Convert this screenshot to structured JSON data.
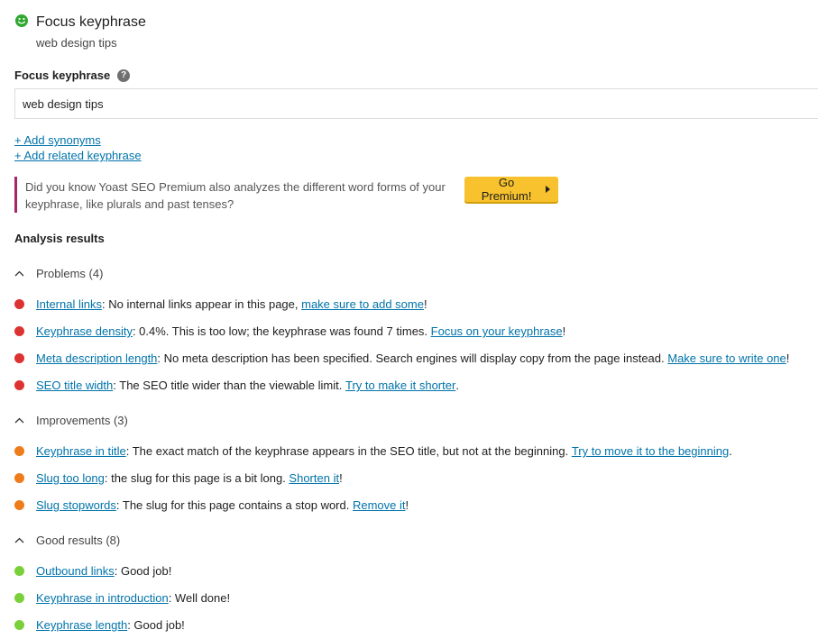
{
  "colors": {
    "link": "#0073aa",
    "bad": "#dc3232",
    "ok": "#ee7c1b",
    "good": "#7ad03a",
    "premium_button": "#f7c22d",
    "notice_border": "#a4286a",
    "smiley": "#30a830"
  },
  "header": {
    "icon": "smiley-icon",
    "title": "Focus keyphrase",
    "subtitle": "web design tips"
  },
  "focus_keyphrase": {
    "label": "Focus keyphrase",
    "help_icon": "?",
    "value": "web design tips",
    "add_synonyms": "+ Add synonyms",
    "add_related": "+ Add related keyphrase"
  },
  "notice": {
    "text": "Did you know Yoast SEO Premium also analyzes the different word forms of your keyphrase, like plurals and past tenses?",
    "button": "Go Premium!"
  },
  "analysis": {
    "title": "Analysis results",
    "problems": {
      "label": "Problems (4)",
      "items": [
        {
          "link": "Internal links",
          "text": ": No internal links appear in this page, ",
          "action": "make sure to add some",
          "end": "!"
        },
        {
          "link": "Keyphrase density",
          "text": ": 0.4%. This is too low; the keyphrase was found 7 times. ",
          "action": "Focus on your keyphrase",
          "end": "!"
        },
        {
          "link": "Meta description length",
          "text": ": No meta description has been specified. Search engines will display copy from the page instead. ",
          "action": "Make sure to write one",
          "end": "!"
        },
        {
          "link": "SEO title width",
          "text": ": The SEO title wider than the viewable limit. ",
          "action": "Try to make it shorter",
          "end": "."
        }
      ]
    },
    "improvements": {
      "label": "Improvements (3)",
      "items": [
        {
          "link": "Keyphrase in title",
          "text": ": The exact match of the keyphrase appears in the SEO title, but not at the beginning. ",
          "action": "Try to move it to the beginning",
          "end": "."
        },
        {
          "link": "Slug too long",
          "text": ": the slug for this page is a bit long. ",
          "action": "Shorten it",
          "end": "!"
        },
        {
          "link": "Slug stopwords",
          "text": ": The slug for this page contains a stop word. ",
          "action": "Remove it",
          "end": "!"
        }
      ]
    },
    "good": {
      "label": "Good results (8)",
      "items": [
        {
          "link": "Outbound links",
          "text": ": Good job!"
        },
        {
          "link": "Keyphrase in introduction",
          "text": ": Well done!"
        },
        {
          "link": "Keyphrase length",
          "text": ": Good job!"
        }
      ]
    }
  }
}
